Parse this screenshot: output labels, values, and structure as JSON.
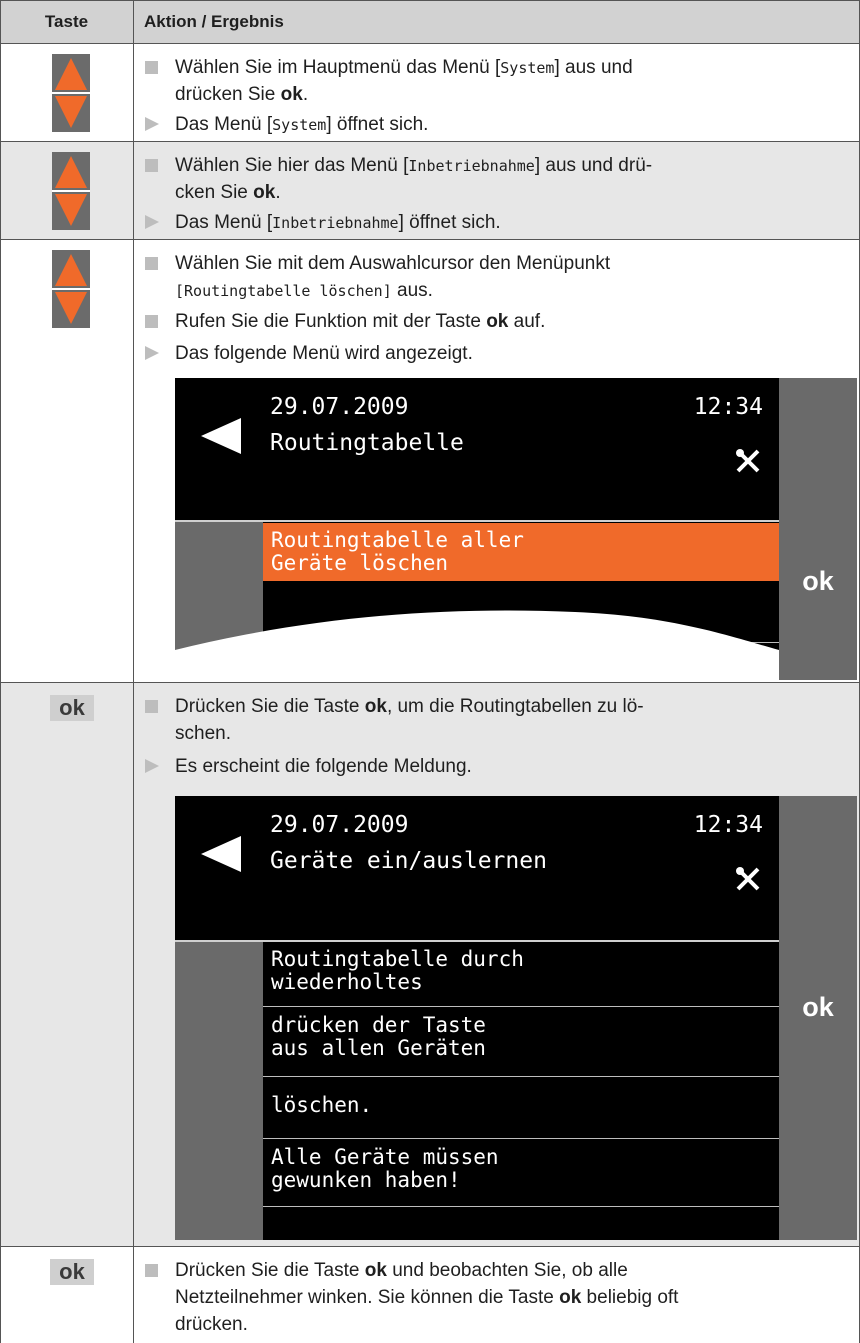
{
  "header": {
    "col1": "Taste",
    "col2": "Aktion / Ergebnis"
  },
  "colors": {
    "orange": "#f06a2a",
    "key_grey": "#6b6b6b",
    "row_grey": "#e7e7e7"
  },
  "rows": [
    {
      "key": "up-down-arrows",
      "l1a": "Wählen Sie im Hauptmenü das Menü [",
      "l1m": "System",
      "l1b": "] aus und",
      "l2a": "drücken Sie ",
      "l2b": "ok",
      "l2c": ".",
      "r1a": "Das Menü [",
      "r1m": "System",
      "r1b": "] öffnet sich."
    },
    {
      "key": "up-down-arrows",
      "l1a": "Wählen Sie hier das Menü [",
      "l1m": "Inbetriebnahme",
      "l1b": "] aus und drü-",
      "l2a": "cken Sie ",
      "l2b": "ok",
      "l2c": ".",
      "r1a": "Das Menü [",
      "r1m": "Inbetriebnahme",
      "r1b": "] öffnet sich."
    },
    {
      "key": "up-down-arrows",
      "l1": "Wählen Sie mit dem Auswahlcursor den Menüpunkt",
      "l2m": "[Routingtabelle löschen]",
      "l2b": " aus.",
      "l3a": "Rufen Sie die Funktion mit der Taste ",
      "l3b": "ok",
      "l3c": " auf.",
      "r1": "Das folgende Menü wird angezeigt.",
      "screen": {
        "date": "29.07.2009",
        "time": "12:34",
        "title": "Routingtabelle",
        "item1": "Routingtabelle aller",
        "item2": "Geräte löschen",
        "ok": "ok"
      }
    },
    {
      "key": "ok",
      "l1a": "Drücken Sie die Taste ",
      "l1b": "ok",
      "l1c": ", um die Routingtabellen zu lö-",
      "l2": "schen.",
      "r1": "Es erscheint die folgende Meldung.",
      "screen": {
        "date": "29.07.2009",
        "time": "12:34",
        "title": "Geräte ein/auslernen",
        "items": [
          [
            "Routingtabelle durch",
            "wiederholtes"
          ],
          [
            "drücken der Taste",
            "aus allen Geräten"
          ],
          [
            "löschen.",
            ""
          ],
          [
            "Alle Geräte müssen",
            "gewunken haben!"
          ]
        ],
        "ok": "ok"
      }
    },
    {
      "key": "ok",
      "l1a": "Drücken Sie die Taste ",
      "l1b": "ok",
      "l1c": " und beobachten Sie, ob alle",
      "l2a": "Netzteilnehmer winken. Sie können die Taste ",
      "l2b": "ok",
      "l2c": " beliebig oft",
      "l3": "drücken."
    }
  ]
}
